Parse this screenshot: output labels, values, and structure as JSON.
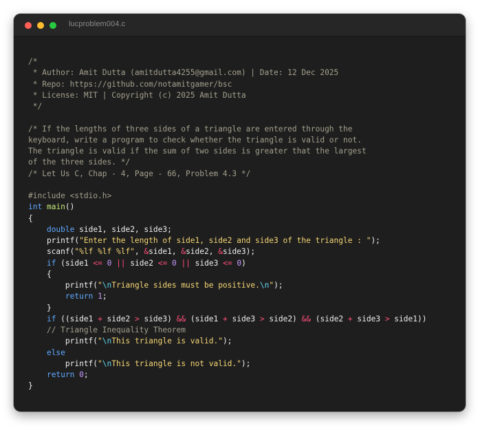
{
  "window": {
    "title": "lucproblem004.c",
    "buttons": {
      "close_color": "#fe5f57",
      "minimize_color": "#febc2e",
      "maximize_color": "#28c840"
    }
  },
  "colors": {
    "background": "#1e1e1e",
    "comment": "#a3a08d",
    "keyword": "#5fa8ff",
    "function": "#c6e97a",
    "string": "#f5d675",
    "operator": "#ff4f7a",
    "number": "#c89bff",
    "escape": "#62d6ee",
    "text": "#f0f0f0"
  },
  "code_lines": [
    [
      [
        "c",
        "/*"
      ]
    ],
    [
      [
        "c",
        " * Author: Amit Dutta (amitdutta4255@gmail.com) | Date: 12 Dec 2025"
      ]
    ],
    [
      [
        "c",
        " * Repo: https://github.com/notamitgamer/bsc"
      ]
    ],
    [
      [
        "c",
        " * License: MIT | Copyright (c) 2025 Amit Dutta"
      ]
    ],
    [
      [
        "c",
        " */"
      ]
    ],
    [],
    [
      [
        "c",
        "/* If the lengths of three sides of a triangle are entered through the"
      ]
    ],
    [
      [
        "c",
        "keyboard, write a program to check whether the triangle is valid or not."
      ]
    ],
    [
      [
        "c",
        "The triangle is valid if the sum of two sides is greater that the largest"
      ]
    ],
    [
      [
        "c",
        "of the three sides. */"
      ]
    ],
    [
      [
        "c",
        "/* Let Us C, Chap - 4, Page - 66, Problem 4.3 */"
      ]
    ],
    [],
    [
      [
        "c",
        "#include <stdio.h>"
      ]
    ],
    [
      [
        "k",
        "int"
      ],
      [
        "p",
        " "
      ],
      [
        "f",
        "main"
      ],
      [
        "p",
        "()"
      ]
    ],
    [
      [
        "p",
        "{"
      ]
    ],
    [
      [
        "p",
        "    "
      ],
      [
        "k",
        "double"
      ],
      [
        "p",
        " side1, side2, side3;"
      ]
    ],
    [
      [
        "p",
        "    printf("
      ],
      [
        "s",
        "\"Enter the length of side1, side2 and side3 of the triangle : \""
      ],
      [
        "p",
        ");"
      ]
    ],
    [
      [
        "p",
        "    scanf("
      ],
      [
        "s",
        "\"%lf %lf %lf\""
      ],
      [
        "p",
        ", "
      ],
      [
        "o",
        "&"
      ],
      [
        "p",
        "side1, "
      ],
      [
        "o",
        "&"
      ],
      [
        "p",
        "side2, "
      ],
      [
        "o",
        "&"
      ],
      [
        "p",
        "side3);"
      ]
    ],
    [
      [
        "p",
        "    "
      ],
      [
        "k",
        "if"
      ],
      [
        "p",
        " (side1 "
      ],
      [
        "o",
        "<="
      ],
      [
        "p",
        " "
      ],
      [
        "n",
        "0"
      ],
      [
        "p",
        " "
      ],
      [
        "o",
        "||"
      ],
      [
        "p",
        " side2 "
      ],
      [
        "o",
        "<="
      ],
      [
        "p",
        " "
      ],
      [
        "n",
        "0"
      ],
      [
        "p",
        " "
      ],
      [
        "o",
        "||"
      ],
      [
        "p",
        " side3 "
      ],
      [
        "o",
        "<="
      ],
      [
        "p",
        " "
      ],
      [
        "n",
        "0"
      ],
      [
        "p",
        ")"
      ]
    ],
    [
      [
        "p",
        "    {"
      ]
    ],
    [
      [
        "p",
        "        printf("
      ],
      [
        "s",
        "\""
      ],
      [
        "e",
        "\\n"
      ],
      [
        "s",
        "Triangle sides must be positive."
      ],
      [
        "e",
        "\\n"
      ],
      [
        "s",
        "\""
      ],
      [
        "p",
        ");"
      ]
    ],
    [
      [
        "p",
        "        "
      ],
      [
        "k",
        "return"
      ],
      [
        "p",
        " "
      ],
      [
        "n",
        "1"
      ],
      [
        "p",
        ";"
      ]
    ],
    [
      [
        "p",
        "    }"
      ]
    ],
    [
      [
        "p",
        "    "
      ],
      [
        "k",
        "if"
      ],
      [
        "p",
        " ((side1 "
      ],
      [
        "o",
        "+"
      ],
      [
        "p",
        " side2 "
      ],
      [
        "o",
        ">"
      ],
      [
        "p",
        " side3) "
      ],
      [
        "o",
        "&&"
      ],
      [
        "p",
        " (side1 "
      ],
      [
        "o",
        "+"
      ],
      [
        "p",
        " side3 "
      ],
      [
        "o",
        ">"
      ],
      [
        "p",
        " side2) "
      ],
      [
        "o",
        "&&"
      ],
      [
        "p",
        " (side2 "
      ],
      [
        "o",
        "+"
      ],
      [
        "p",
        " side3 "
      ],
      [
        "o",
        ">"
      ],
      [
        "p",
        " side1))"
      ]
    ],
    [
      [
        "p",
        "    "
      ],
      [
        "c",
        "// Triangle Inequality Theorem"
      ]
    ],
    [
      [
        "p",
        "        printf("
      ],
      [
        "s",
        "\""
      ],
      [
        "e",
        "\\n"
      ],
      [
        "s",
        "This triangle is valid.\""
      ],
      [
        "p",
        ");"
      ]
    ],
    [
      [
        "p",
        "    "
      ],
      [
        "k",
        "else"
      ]
    ],
    [
      [
        "p",
        "        printf("
      ],
      [
        "s",
        "\""
      ],
      [
        "e",
        "\\n"
      ],
      [
        "s",
        "This triangle is not valid.\""
      ],
      [
        "p",
        ");"
      ]
    ],
    [
      [
        "p",
        "    "
      ],
      [
        "k",
        "return"
      ],
      [
        "p",
        " "
      ],
      [
        "n",
        "0"
      ],
      [
        "p",
        ";"
      ]
    ],
    [
      [
        "p",
        "}"
      ]
    ]
  ]
}
